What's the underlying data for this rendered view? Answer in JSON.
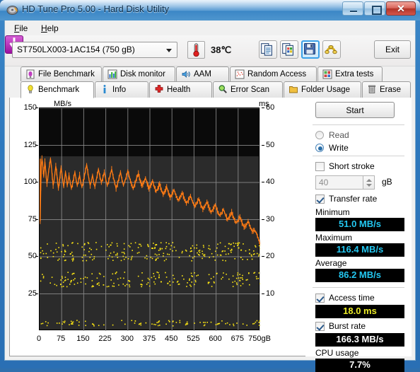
{
  "window": {
    "title": "HD Tune Pro 5.00 - Hard Disk Utility",
    "icon": "hard-disk-icon",
    "minimize": "minimize-icon",
    "maximize": "maximize-icon",
    "close": "✕"
  },
  "menu": {
    "file": "File",
    "help": "Help"
  },
  "toolbar": {
    "drive": "ST750LX003-1AC154 (750 gB)",
    "temperature": "38℃",
    "exit_label": "Exit",
    "buttons": [
      {
        "name": "copy-to-clipboard-button",
        "icon": "copy-text-icon"
      },
      {
        "name": "copy-image-button",
        "icon": "copy-image-icon"
      },
      {
        "name": "save-button",
        "icon": "floppy-save-icon"
      },
      {
        "name": "disk-tools-button",
        "icon": "coiled-pipe-icon"
      },
      {
        "name": "download-button",
        "icon": "purple-down-arrow-icon"
      }
    ]
  },
  "tabs_top": [
    {
      "label": "File Benchmark",
      "icon": "file-benchmark-icon"
    },
    {
      "label": "Disk monitor",
      "icon": "bar-chart-icon"
    },
    {
      "label": "AAM",
      "icon": "speaker-icon"
    },
    {
      "label": "Random Access",
      "icon": "scatter-icon"
    },
    {
      "label": "Extra tests",
      "icon": "grid-chart-icon"
    }
  ],
  "tabs_bottom": [
    {
      "label": "Benchmark",
      "icon": "lightbulb-icon",
      "selected": true
    },
    {
      "label": "Info",
      "icon": "info-icon",
      "selected": false
    },
    {
      "label": "Health",
      "icon": "red-cross-icon",
      "selected": false
    },
    {
      "label": "Error Scan",
      "icon": "magnifier-icon",
      "selected": false
    },
    {
      "label": "Folder Usage",
      "icon": "folder-icon",
      "selected": false
    },
    {
      "label": "Erase",
      "icon": "trash-icon",
      "selected": false
    }
  ],
  "controls": {
    "start_label": "Start",
    "read_label": "Read",
    "write_label": "Write",
    "read_selected": false,
    "write_selected": true,
    "short_stroke_label": "Short stroke",
    "short_stroke_checked": false,
    "short_stroke_value": "40",
    "short_stroke_unit": "gB",
    "transfer_rate_label": "Transfer rate",
    "transfer_rate_checked": true,
    "access_time_label": "Access time",
    "access_time_checked": true,
    "burst_rate_label": "Burst rate",
    "burst_rate_checked": true
  },
  "results": {
    "minimum_label": "Minimum",
    "minimum_value": "51.0 MB/s",
    "maximum_label": "Maximum",
    "maximum_value": "116.4 MB/s",
    "average_label": "Average",
    "average_value": "86.2 MB/s",
    "access_time_value": "18.0 ms",
    "burst_rate_value": "166.3 MB/s",
    "cpu_usage_label": "CPU usage",
    "cpu_usage_value": "7.7%"
  },
  "colors": {
    "transfer_curve": "#ff7b14",
    "access_points": "#ffe813",
    "value_cyan": "#23c8f2",
    "value_yellow": "#ecec28",
    "value_white": "#ffffff",
    "plot_bg": "#2b2b2b",
    "plot_bg_top": "#0a0a0a",
    "grid": "#8c8c8c"
  },
  "chart_data": {
    "type": "line",
    "title": "",
    "xlabel": "gB",
    "ylabel": "MB/s",
    "y2label": "ms",
    "xlim": [
      0,
      750
    ],
    "ylim": [
      0,
      150
    ],
    "y2lim": [
      0,
      60
    ],
    "xticks": [
      0,
      75,
      150,
      225,
      300,
      375,
      450,
      525,
      600,
      675,
      750
    ],
    "xtick_labels": [
      "0",
      "75",
      "150",
      "225",
      "300",
      "375",
      "450",
      "525",
      "600",
      "675",
      "750gB"
    ],
    "yticks": [
      0,
      25,
      50,
      75,
      100,
      125,
      150
    ],
    "ytick_labels": [
      "0",
      "25",
      "50",
      "75",
      "100",
      "125",
      "150"
    ],
    "y2ticks": [
      0,
      10,
      20,
      30,
      40,
      50,
      60
    ],
    "y2tick_labels": [
      "0",
      "10",
      "20",
      "30",
      "40",
      "50",
      "60"
    ],
    "grid": true,
    "legend": false,
    "series": [
      {
        "name": "Transfer rate",
        "type": "line",
        "color": "#ff7b14",
        "axis": "left",
        "unit": "MB/s",
        "x": [
          2,
          4,
          6,
          8,
          10,
          12,
          14,
          16,
          18,
          20,
          22,
          25,
          28,
          31,
          34,
          37,
          40,
          43,
          46,
          49,
          52,
          55,
          58,
          61,
          64,
          67,
          70,
          73,
          76,
          79,
          82,
          85,
          88,
          91,
          94,
          97,
          100,
          104,
          108,
          112,
          116,
          120,
          124,
          128,
          132,
          136,
          140,
          144,
          148,
          152,
          156,
          160,
          164,
          168,
          172,
          176,
          180,
          184,
          188,
          192,
          196,
          200,
          205,
          210,
          215,
          220,
          225,
          230,
          235,
          240,
          245,
          250,
          255,
          260,
          265,
          270,
          275,
          280,
          285,
          290,
          295,
          300,
          306,
          312,
          318,
          324,
          330,
          336,
          342,
          348,
          354,
          360,
          366,
          372,
          378,
          384,
          390,
          396,
          402,
          408,
          414,
          420,
          426,
          432,
          438,
          444,
          450,
          457,
          464,
          471,
          478,
          485,
          492,
          499,
          506,
          513,
          520,
          527,
          534,
          541,
          548,
          555,
          562,
          569,
          576,
          583,
          590,
          597,
          604,
          611,
          618,
          625,
          632,
          639,
          646,
          653,
          660,
          667,
          674,
          681,
          688,
          695,
          702,
          709,
          716,
          723,
          730,
          737,
          744,
          750
        ],
        "y": [
          74,
          96,
          112,
          116,
          113,
          108,
          104,
          109,
          114,
          110,
          105,
          99,
          103,
          108,
          112,
          116,
          111,
          104,
          98,
          101,
          106,
          111,
          107,
          101,
          96,
          100,
          105,
          110,
          106,
          101,
          97,
          102,
          107,
          103,
          98,
          101,
          105,
          100,
          96,
          99,
          103,
          107,
          102,
          98,
          101,
          105,
          100,
          97,
          100,
          104,
          108,
          112,
          107,
          102,
          98,
          101,
          105,
          100,
          97,
          101,
          105,
          109,
          104,
          100,
          103,
          107,
          102,
          98,
          101,
          105,
          109,
          104,
          100,
          96,
          99,
          103,
          107,
          102,
          98,
          101,
          104,
          108,
          103,
          99,
          96,
          99,
          103,
          106,
          101,
          98,
          100,
          103,
          99,
          96,
          98,
          101,
          97,
          94,
          96,
          99,
          95,
          92,
          94,
          97,
          93,
          90,
          92,
          95,
          91,
          88,
          90,
          93,
          89,
          86,
          88,
          91,
          87,
          84,
          86,
          89,
          85,
          82,
          84,
          87,
          83,
          80,
          82,
          85,
          81,
          78,
          79,
          82,
          78,
          75,
          77,
          80,
          76,
          73,
          74,
          77,
          73,
          70,
          71,
          74,
          70,
          67,
          68,
          66,
          62,
          58
        ],
        "statistics": {
          "minimum": 51.0,
          "maximum": 116.4,
          "average": 86.2
        }
      },
      {
        "name": "Access time",
        "type": "scatter",
        "color": "#ffe813",
        "axis": "right",
        "unit": "ms",
        "average": 18.0,
        "cluster_main_ms": [
          19,
          24
        ],
        "cluster_secondary_ms": [
          12,
          16
        ],
        "cluster_low_ms": [
          1.5,
          3
        ],
        "point_count": 520
      }
    ]
  }
}
